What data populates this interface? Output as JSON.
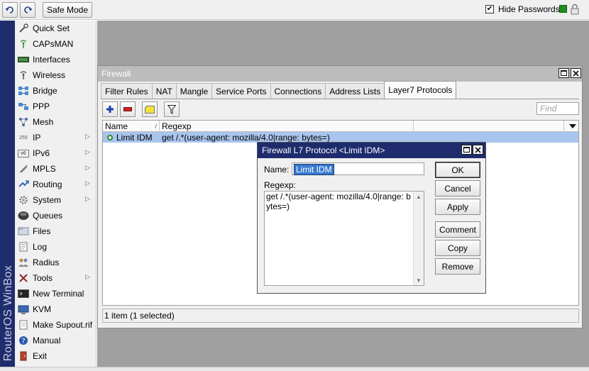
{
  "toolbar": {
    "undo_icon": "undo-icon",
    "redo_icon": "redo-icon",
    "safe_mode": "Safe Mode",
    "hide_passwords": "Hide Passwords",
    "hide_passwords_checked": true,
    "status_color": "#1e8f1e"
  },
  "sidebar": {
    "brand": "RouterOS WinBox",
    "items": [
      {
        "label": "Quick Set",
        "icon": "quick-set-icon",
        "submenu": false
      },
      {
        "label": "CAPsMAN",
        "icon": "capsman-icon",
        "submenu": false
      },
      {
        "label": "Interfaces",
        "icon": "interfaces-icon",
        "submenu": false
      },
      {
        "label": "Wireless",
        "icon": "wireless-icon",
        "submenu": false
      },
      {
        "label": "Bridge",
        "icon": "bridge-icon",
        "submenu": false
      },
      {
        "label": "PPP",
        "icon": "ppp-icon",
        "submenu": false
      },
      {
        "label": "Mesh",
        "icon": "mesh-icon",
        "submenu": false
      },
      {
        "label": "IP",
        "icon": "ip-icon",
        "submenu": true
      },
      {
        "label": "IPv6",
        "icon": "ipv6-icon",
        "submenu": true
      },
      {
        "label": "MPLS",
        "icon": "mpls-icon",
        "submenu": true
      },
      {
        "label": "Routing",
        "icon": "routing-icon",
        "submenu": true
      },
      {
        "label": "System",
        "icon": "system-icon",
        "submenu": true
      },
      {
        "label": "Queues",
        "icon": "queues-icon",
        "submenu": false
      },
      {
        "label": "Files",
        "icon": "files-icon",
        "submenu": false
      },
      {
        "label": "Log",
        "icon": "log-icon",
        "submenu": false
      },
      {
        "label": "Radius",
        "icon": "radius-icon",
        "submenu": false
      },
      {
        "label": "Tools",
        "icon": "tools-icon",
        "submenu": true
      },
      {
        "label": "New Terminal",
        "icon": "terminal-icon",
        "submenu": false
      },
      {
        "label": "KVM",
        "icon": "kvm-icon",
        "submenu": false
      },
      {
        "label": "Make Supout.rif",
        "icon": "supout-icon",
        "submenu": false
      },
      {
        "label": "Manual",
        "icon": "manual-icon",
        "submenu": false
      },
      {
        "label": "Exit",
        "icon": "exit-icon",
        "submenu": false
      }
    ]
  },
  "firewall": {
    "title": "Firewall",
    "tabs": [
      "Filter Rules",
      "NAT",
      "Mangle",
      "Service Ports",
      "Connections",
      "Address Lists",
      "Layer7 Protocols"
    ],
    "active_tab": "Layer7 Protocols",
    "find_placeholder": "Find",
    "columns": [
      "Name",
      "Regexp"
    ],
    "rows": [
      {
        "name": "Limit IDM",
        "regexp": "get /.*(user-agent: mozilla/4.0|range: bytes=)",
        "selected": true
      }
    ],
    "status": "1 item (1 selected)"
  },
  "dialog": {
    "title": "Firewall L7 Protocol <Limit IDM>",
    "name_label": "Name:",
    "name_value": "Limit IDM",
    "regexp_label": "Regexp:",
    "regexp_value": "get /.*(user-agent: mozilla/4.0|range: bytes=)",
    "buttons": {
      "ok": "OK",
      "cancel": "Cancel",
      "apply": "Apply",
      "comment": "Comment",
      "copy": "Copy",
      "remove": "Remove"
    }
  }
}
